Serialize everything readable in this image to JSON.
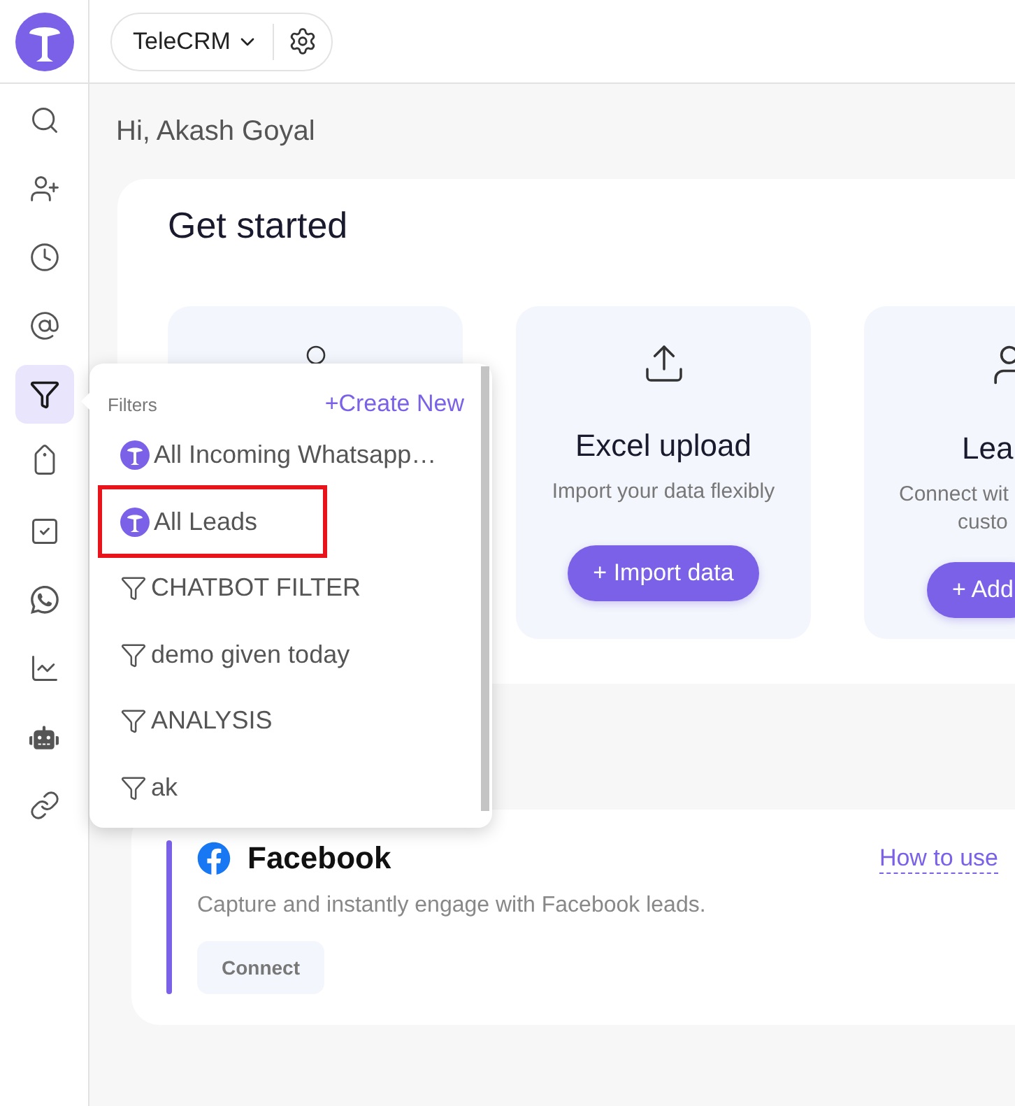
{
  "workspace": {
    "name": "TeleCRM"
  },
  "nav": [
    {
      "selected": false
    },
    {
      "selected": false
    },
    {
      "selected": false
    },
    {
      "selected": false
    },
    {
      "selected": true
    },
    {
      "selected": false
    },
    {
      "selected": false
    },
    {
      "selected": false
    },
    {
      "selected": false
    },
    {
      "selected": false
    },
    {
      "selected": false
    }
  ],
  "greeting": "Hi, Akash Goyal",
  "get_started": {
    "title": "Get started",
    "cards": [
      {
        "kind": "covered"
      },
      {
        "kind": "upload",
        "title": "Excel upload",
        "description": [
          "Import your data flexibly"
        ],
        "button": "+ Import data"
      },
      {
        "kind": "person",
        "title": "Lea",
        "description": [
          "Connect wit",
          "custo"
        ],
        "button": "+ Add"
      }
    ]
  },
  "filters_menu": {
    "title": "Filters",
    "create": "+Create New",
    "items": [
      {
        "kind": "app",
        "label": "All Incoming Whatsapp…",
        "highlighted": false
      },
      {
        "kind": "app",
        "label": "All Leads",
        "highlighted": true
      },
      {
        "kind": "filter",
        "label": "CHATBOT FILTER",
        "highlighted": false
      },
      {
        "kind": "filter",
        "label": "demo given today",
        "highlighted": false
      },
      {
        "kind": "filter",
        "label": "ANALYSIS",
        "highlighted": false
      },
      {
        "kind": "filter",
        "label": "ak",
        "highlighted": false
      }
    ]
  },
  "integration": {
    "title": "Facebook",
    "link": "How to use",
    "description": "Capture and instantly engage with Facebook leads.",
    "button": "Connect"
  }
}
